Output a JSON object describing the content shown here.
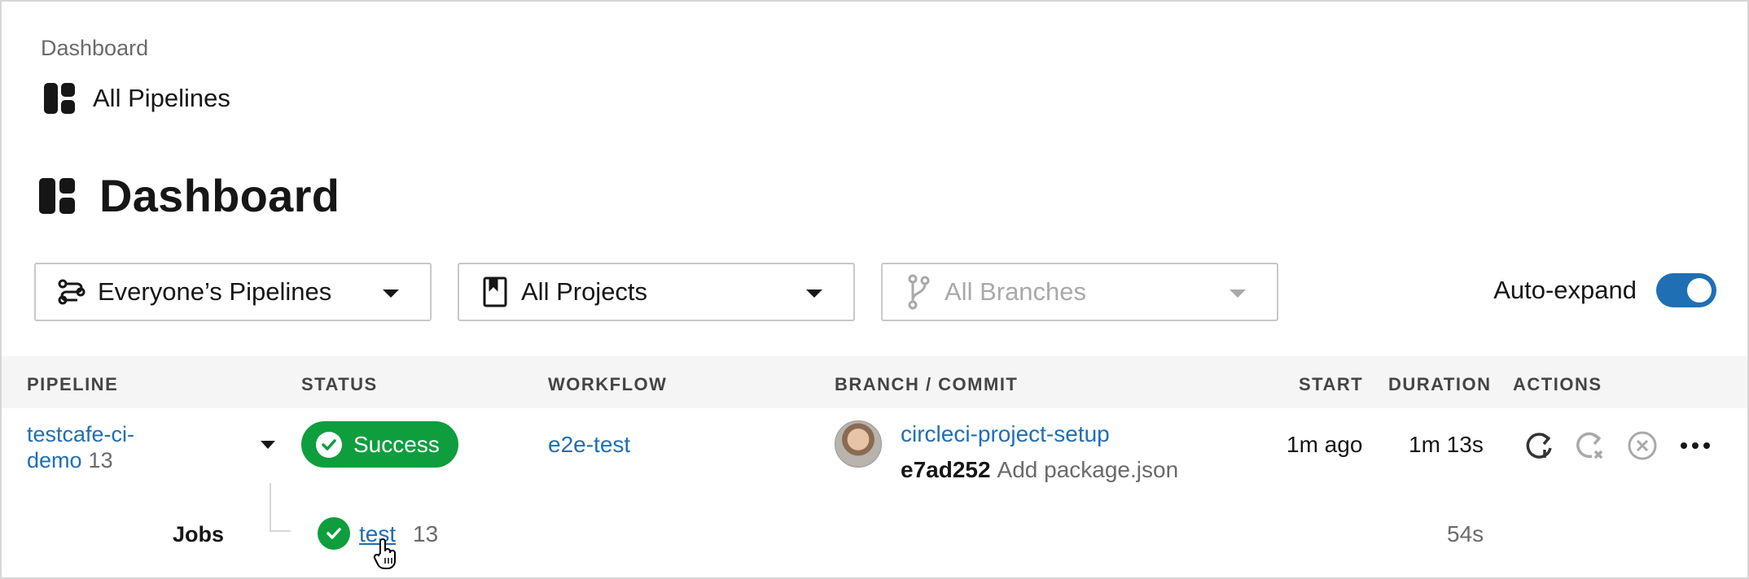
{
  "breadcrumb": {
    "parent": "Dashboard",
    "current": "All Pipelines",
    "icon": "dashboard-grid-icon"
  },
  "page": {
    "title": "Dashboard",
    "icon": "dashboard-grid-icon"
  },
  "filters": {
    "pipelines": {
      "label": "Everyone’s Pipelines",
      "icon": "pipelines-icon"
    },
    "projects": {
      "label": "All Projects",
      "icon": "project-bookmark-icon"
    },
    "branches": {
      "label": "All Branches",
      "icon": "branch-icon",
      "disabled": true
    }
  },
  "auto_expand": {
    "label": "Auto-expand",
    "enabled": true
  },
  "table": {
    "columns": [
      "PIPELINE",
      "STATUS",
      "WORKFLOW",
      "BRANCH / COMMIT",
      "START",
      "DURATION",
      "ACTIONS"
    ],
    "rows": [
      {
        "pipeline_name_line1": "testcafe-ci-",
        "pipeline_name_line2": "demo",
        "pipeline_number": "13",
        "status": "Success",
        "workflow": "e2e-test",
        "branch": "circleci-project-setup",
        "commit_hash": "e7ad252",
        "commit_message": "Add package.json",
        "start": "1m ago",
        "duration": "1m 13s",
        "actions": [
          "rerun-icon",
          "rerun-failed-icon",
          "cancel-icon",
          "more-icon"
        ],
        "jobs_label": "Jobs",
        "jobs": [
          {
            "name": "test",
            "number": "13",
            "duration": "54s",
            "status": "success"
          }
        ]
      }
    ]
  },
  "colors": {
    "link": "#1f6fb5",
    "success": "#0e9e3e",
    "header_bg": "#f5f5f5",
    "toggle_on": "#1f6fb5"
  }
}
